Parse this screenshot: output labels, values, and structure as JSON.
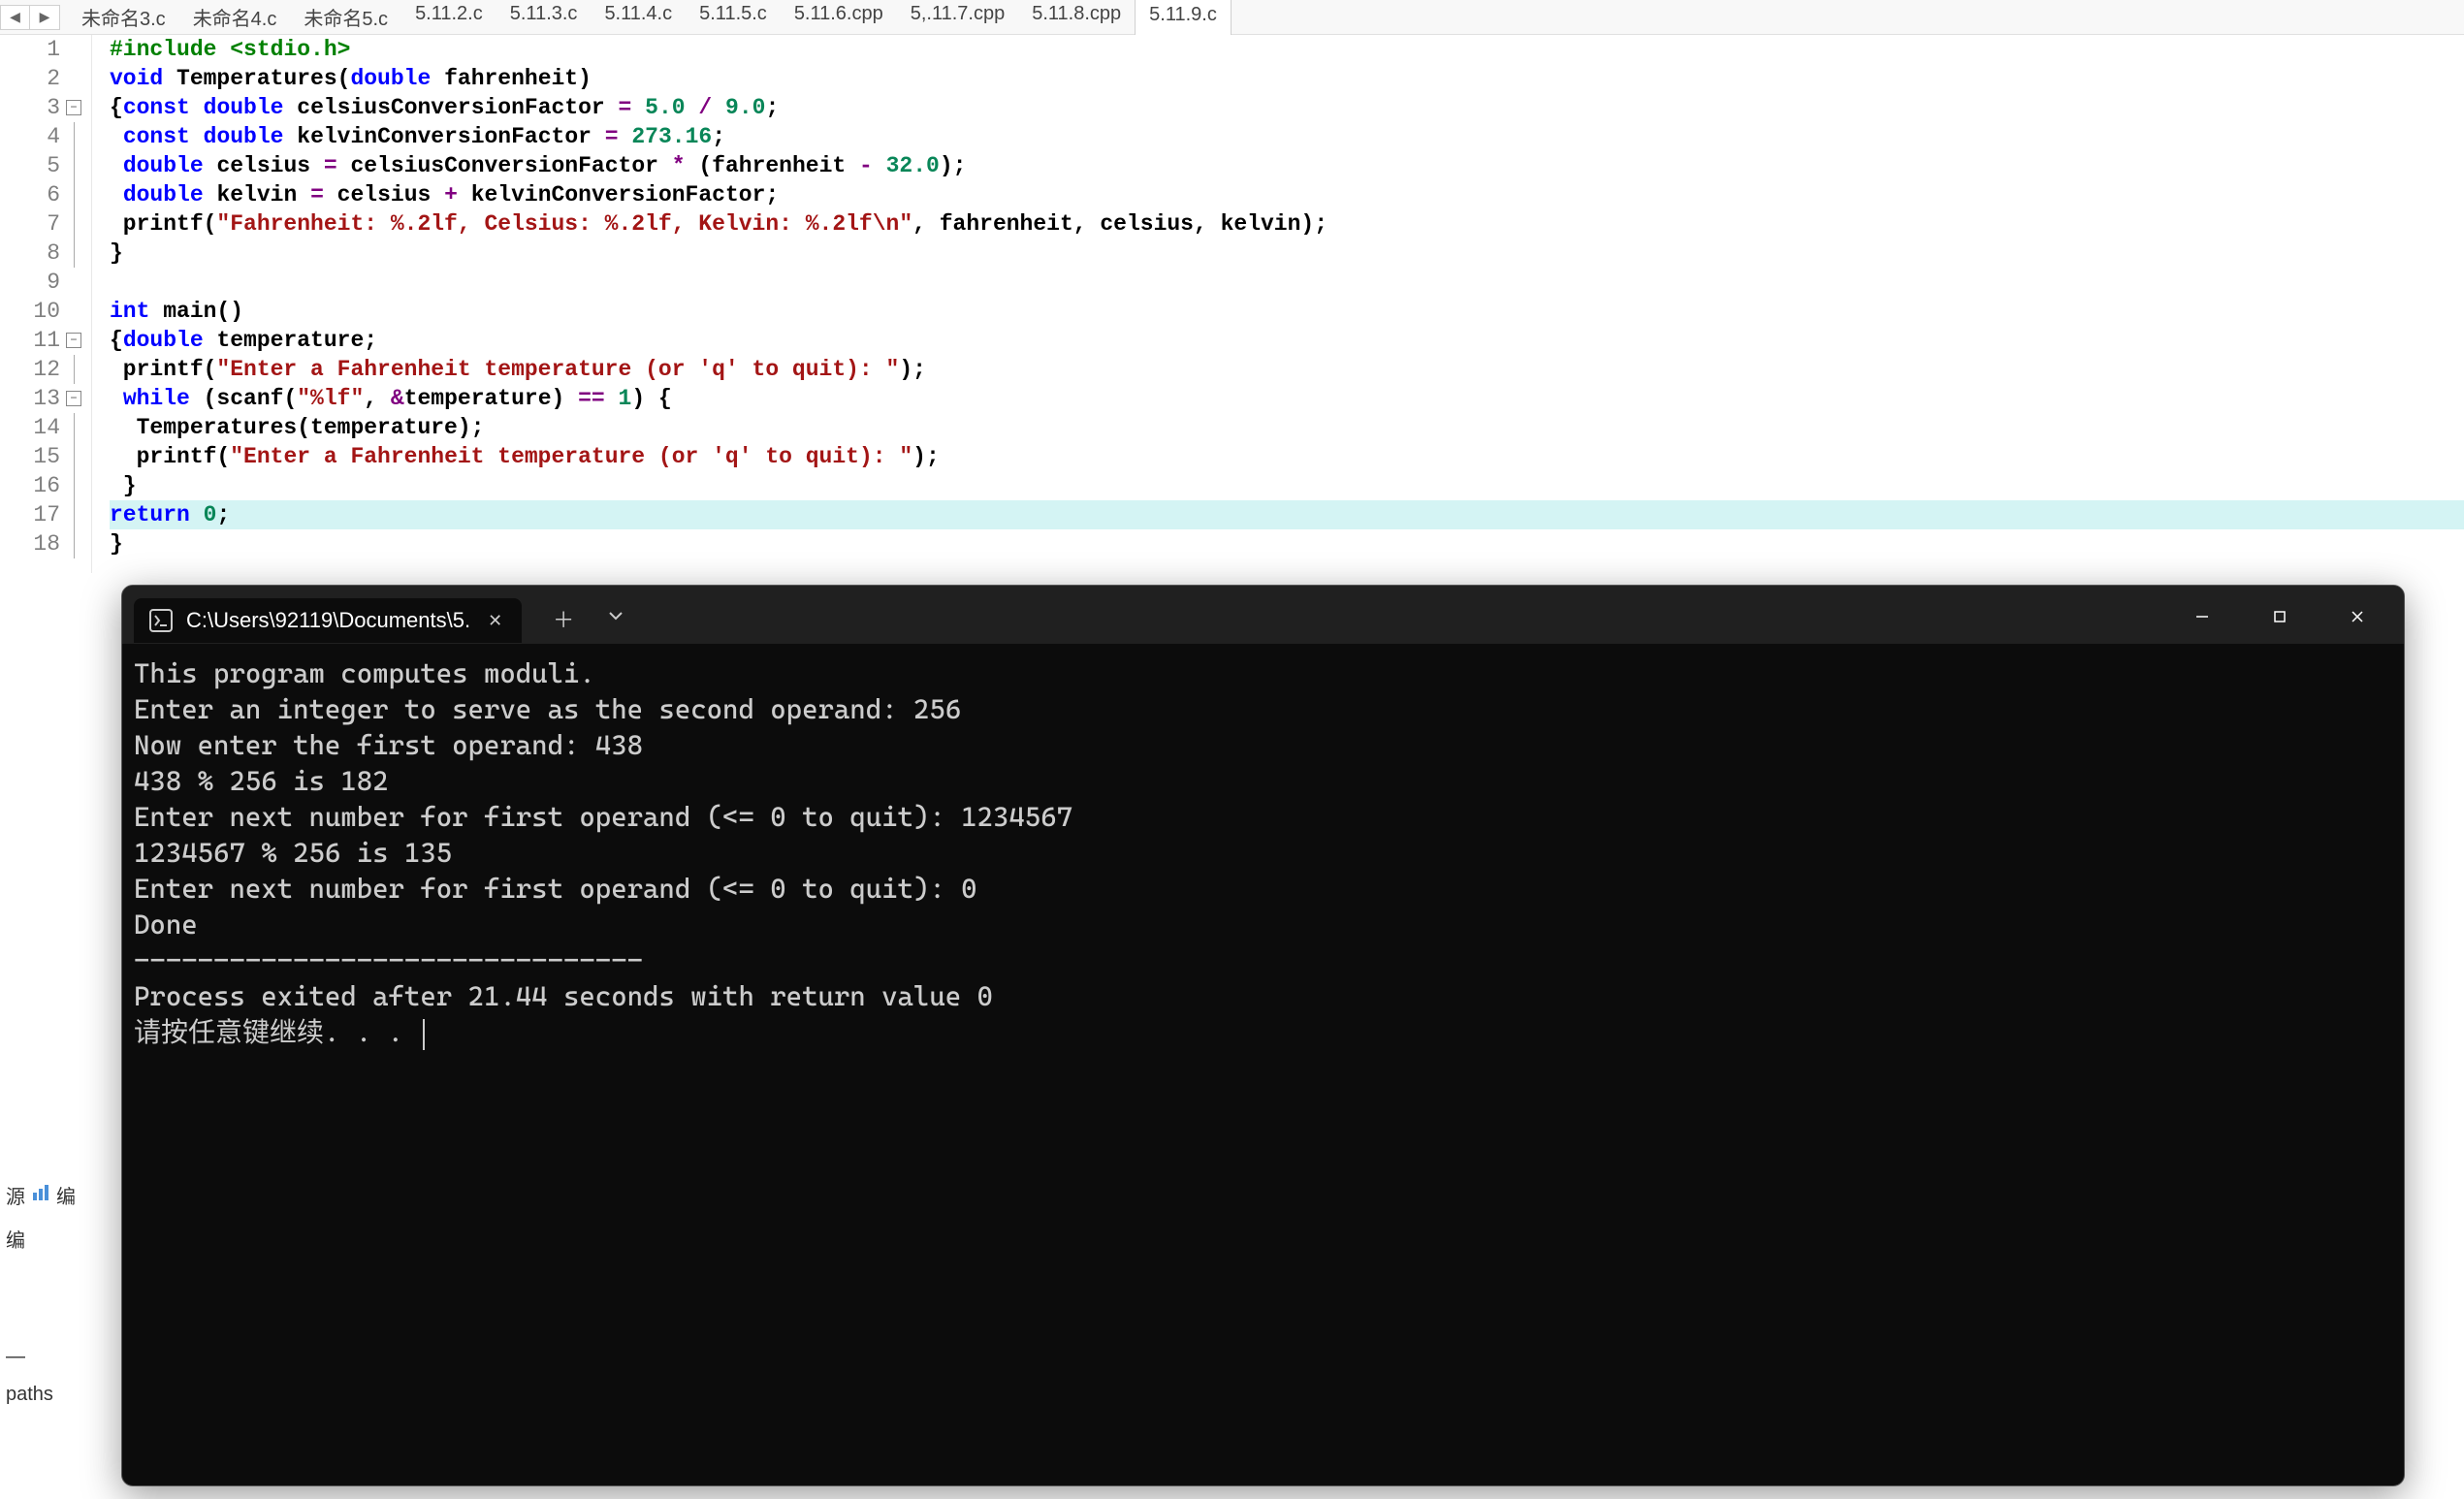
{
  "tabs": [
    "未命名3.c",
    "未命名4.c",
    "未命名5.c",
    "5.11.2.c",
    "5.11.3.c",
    "5.11.4.c",
    "5.11.5.c",
    "5.11.6.cpp",
    "5,.11.7.cpp",
    "5.11.8.cpp",
    "5.11.9.c"
  ],
  "active_tab": "5.11.9.c",
  "code": {
    "lines": [
      {
        "n": 1,
        "fold": "",
        "tokens": [
          [
            "pp",
            "#include"
          ],
          [
            "plain",
            " "
          ],
          [
            "pp-inc",
            "<stdio.h>"
          ]
        ]
      },
      {
        "n": 2,
        "fold": "",
        "tokens": [
          [
            "kw",
            "void"
          ],
          [
            "plain",
            " Temperatures("
          ],
          [
            "kw",
            "double"
          ],
          [
            "plain",
            " fahrenheit)"
          ]
        ]
      },
      {
        "n": 3,
        "fold": "box",
        "tokens": [
          [
            "plain",
            "{"
          ],
          [
            "kw",
            "const"
          ],
          [
            "plain",
            " "
          ],
          [
            "kw",
            "double"
          ],
          [
            "plain",
            " celsiusConversionFactor "
          ],
          [
            "op",
            "="
          ],
          [
            "plain",
            " "
          ],
          [
            "num",
            "5.0"
          ],
          [
            "plain",
            " "
          ],
          [
            "op",
            "/"
          ],
          [
            "plain",
            " "
          ],
          [
            "num",
            "9.0"
          ],
          [
            "plain",
            ";"
          ]
        ]
      },
      {
        "n": 4,
        "fold": "line",
        "tokens": [
          [
            "plain",
            " "
          ],
          [
            "kw",
            "const"
          ],
          [
            "plain",
            " "
          ],
          [
            "kw",
            "double"
          ],
          [
            "plain",
            " kelvinConversionFactor "
          ],
          [
            "op",
            "="
          ],
          [
            "plain",
            " "
          ],
          [
            "num",
            "273.16"
          ],
          [
            "plain",
            ";"
          ]
        ]
      },
      {
        "n": 5,
        "fold": "line",
        "tokens": [
          [
            "plain",
            " "
          ],
          [
            "kw",
            "double"
          ],
          [
            "plain",
            " celsius "
          ],
          [
            "op",
            "="
          ],
          [
            "plain",
            " celsiusConversionFactor "
          ],
          [
            "op",
            "*"
          ],
          [
            "plain",
            " (fahrenheit "
          ],
          [
            "op",
            "-"
          ],
          [
            "plain",
            " "
          ],
          [
            "num",
            "32.0"
          ],
          [
            "plain",
            ");"
          ]
        ]
      },
      {
        "n": 6,
        "fold": "line",
        "tokens": [
          [
            "plain",
            " "
          ],
          [
            "kw",
            "double"
          ],
          [
            "plain",
            " kelvin "
          ],
          [
            "op",
            "="
          ],
          [
            "plain",
            " celsius "
          ],
          [
            "op",
            "+"
          ],
          [
            "plain",
            " kelvinConversionFactor;"
          ]
        ]
      },
      {
        "n": 7,
        "fold": "line",
        "tokens": [
          [
            "plain",
            " printf("
          ],
          [
            "str",
            "\"Fahrenheit: %.2lf, Celsius: %.2lf, Kelvin: %.2lf\\n\""
          ],
          [
            "plain",
            ", fahrenheit, celsius, kelvin);"
          ]
        ]
      },
      {
        "n": 8,
        "fold": "end",
        "tokens": [
          [
            "plain",
            "}"
          ]
        ]
      },
      {
        "n": 9,
        "fold": "",
        "tokens": [
          [
            "plain",
            ""
          ]
        ]
      },
      {
        "n": 10,
        "fold": "",
        "tokens": [
          [
            "kw",
            "int"
          ],
          [
            "plain",
            " main()"
          ]
        ]
      },
      {
        "n": 11,
        "fold": "box",
        "tokens": [
          [
            "plain",
            "{"
          ],
          [
            "kw",
            "double"
          ],
          [
            "plain",
            " temperature;"
          ]
        ]
      },
      {
        "n": 12,
        "fold": "line",
        "tokens": [
          [
            "plain",
            " printf("
          ],
          [
            "str",
            "\"Enter a Fahrenheit temperature (or 'q' to quit): \""
          ],
          [
            "plain",
            ");"
          ]
        ]
      },
      {
        "n": 13,
        "fold": "box",
        "tokens": [
          [
            "plain",
            " "
          ],
          [
            "kw",
            "while"
          ],
          [
            "plain",
            " (scanf("
          ],
          [
            "str",
            "\"%lf\""
          ],
          [
            "plain",
            ", "
          ],
          [
            "op",
            "&"
          ],
          [
            "plain",
            "temperature) "
          ],
          [
            "op",
            "=="
          ],
          [
            "plain",
            " "
          ],
          [
            "num",
            "1"
          ],
          [
            "plain",
            ") {"
          ]
        ]
      },
      {
        "n": 14,
        "fold": "line",
        "tokens": [
          [
            "plain",
            "  Temperatures(temperature);"
          ]
        ]
      },
      {
        "n": 15,
        "fold": "line",
        "tokens": [
          [
            "plain",
            "  printf("
          ],
          [
            "str",
            "\"Enter a Fahrenheit temperature (or 'q' to quit): \""
          ],
          [
            "plain",
            ");"
          ]
        ]
      },
      {
        "n": 16,
        "fold": "end",
        "tokens": [
          [
            "plain",
            " }"
          ]
        ]
      },
      {
        "n": 17,
        "fold": "line",
        "tokens": [
          [
            "kw",
            "return"
          ],
          [
            "plain",
            " "
          ],
          [
            "num",
            "0"
          ],
          [
            "plain",
            ";"
          ]
        ],
        "hl": true
      },
      {
        "n": 18,
        "fold": "end",
        "tokens": [
          [
            "plain",
            "}"
          ]
        ]
      }
    ]
  },
  "terminal": {
    "title": "C:\\Users\\92119\\Documents\\5.",
    "lines": [
      "This program computes moduli.",
      "Enter an integer to serve as the second operand: 256",
      "Now enter the first operand: 438",
      "438 % 256 is 182",
      "Enter next number for first operand (<= 0 to quit): 1234567",
      "1234567 % 256 is 135",
      "Enter next number for first operand (<= 0 to quit): 0",
      "Done",
      "",
      "--------------------------------",
      "Process exited after 21.44 seconds with return value 0",
      "请按任意键继续. . . "
    ]
  },
  "left_panel": {
    "item1": "源",
    "item2": "编",
    "item3": "编",
    "item4": "paths"
  }
}
